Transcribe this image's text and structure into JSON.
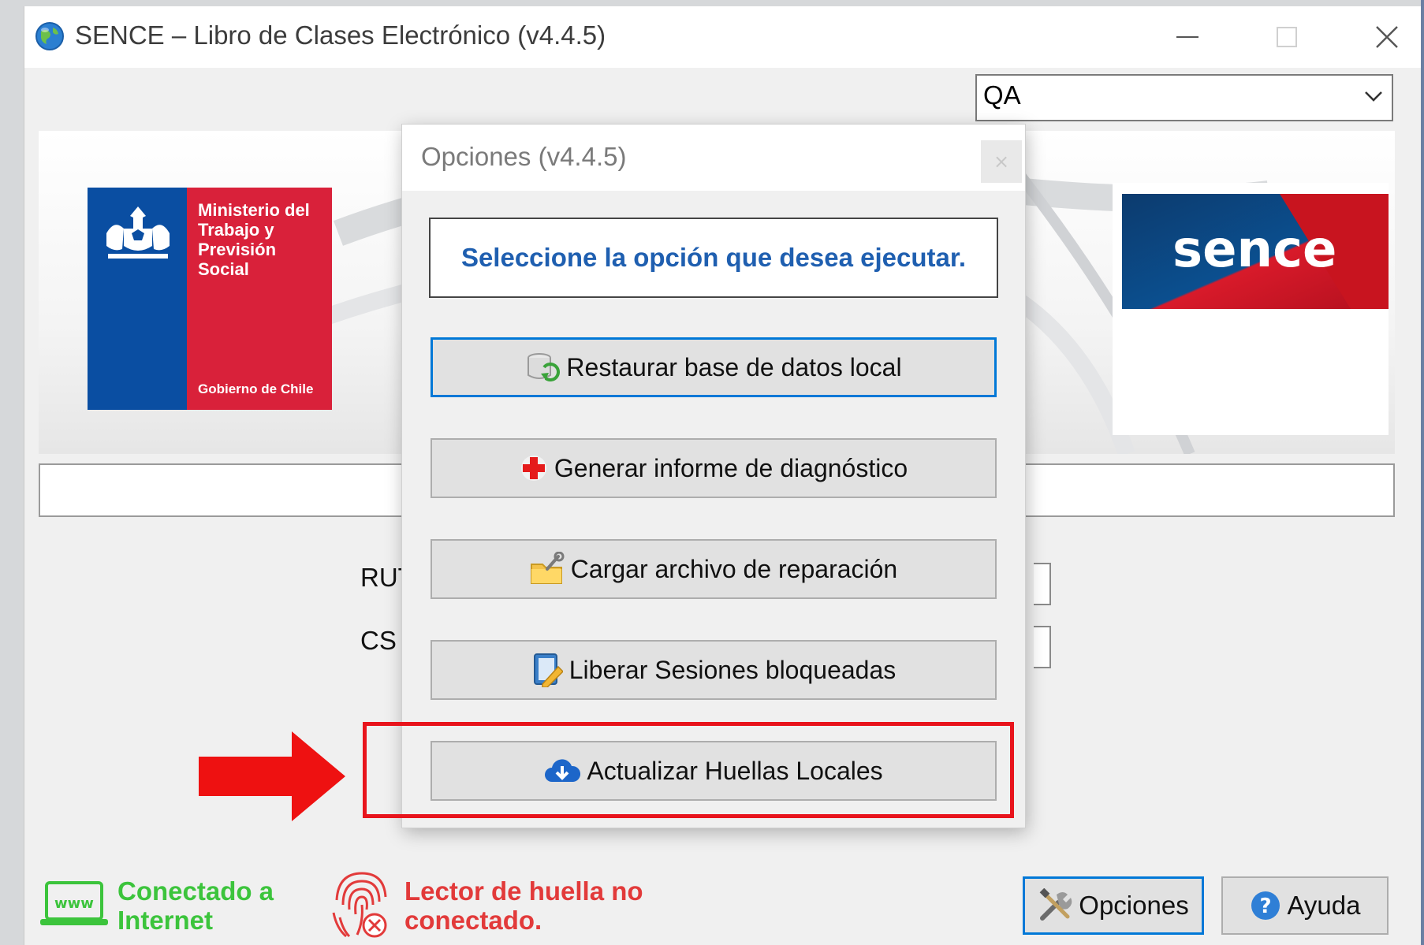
{
  "window": {
    "title": "SENCE – Libro de Clases Electrónico (v4.4.5)"
  },
  "environment": {
    "selected": "QA"
  },
  "banner": {
    "ministry_name": "Ministerio del Trabajo y Previsión Social",
    "government": "Gobierno de Chile",
    "brand": "sence"
  },
  "form": {
    "rut_label": "RUT",
    "cs_label": "CS ("
  },
  "status": {
    "internet": "Conectado a Internet",
    "reader": "Lector de huella no conectado."
  },
  "buttons": {
    "opciones": "Opciones",
    "ayuda": "Ayuda"
  },
  "dialog": {
    "title": "Opciones (v4.4.5)",
    "close": "×",
    "instruction": "Seleccione la opción que desea ejecutar.",
    "options": [
      {
        "label": "Restaurar base de datos local"
      },
      {
        "label": "Generar informe de diagnóstico"
      },
      {
        "label": "Cargar archivo de reparación"
      },
      {
        "label": "Liberar Sesiones bloqueadas"
      },
      {
        "label": "Actualizar Huellas Locales"
      }
    ]
  },
  "colors": {
    "accent": "#0078d7",
    "highlight": "#e8141c",
    "connected": "#3cc43c",
    "disconnected": "#e23a3a",
    "instruction": "#1f5fb0"
  }
}
